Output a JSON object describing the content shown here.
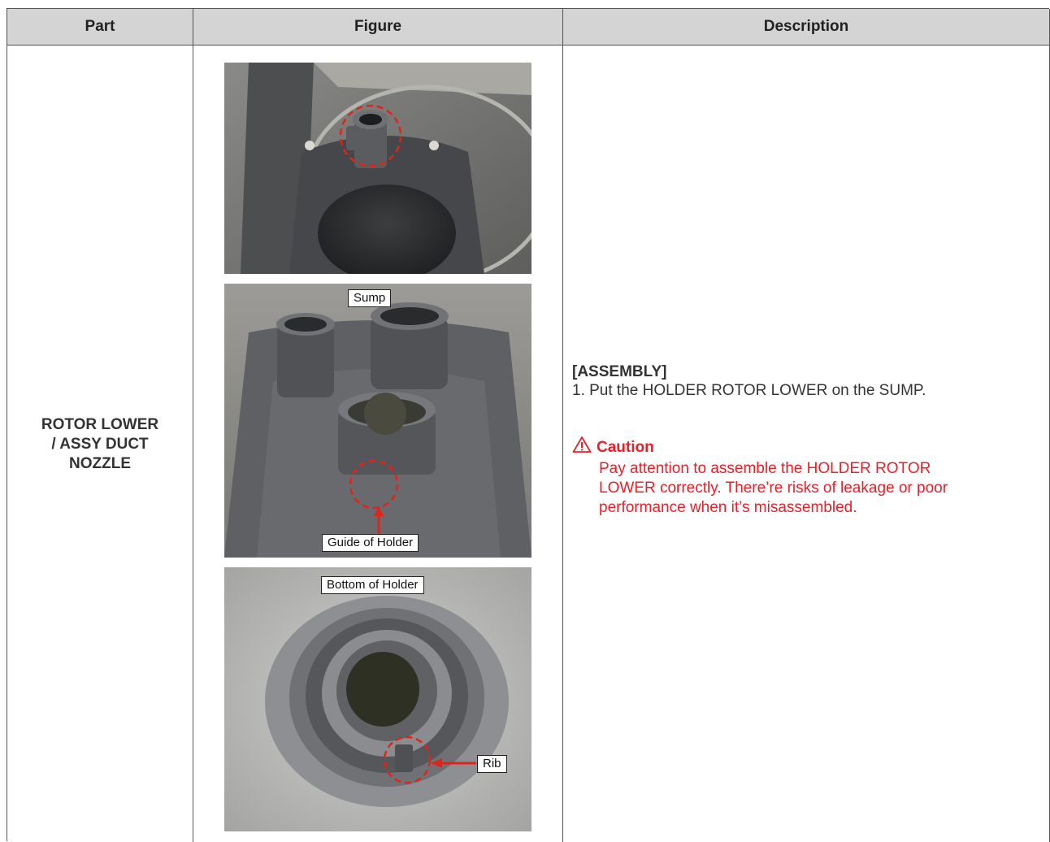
{
  "table": {
    "headers": {
      "part": "Part",
      "figure": "Figure",
      "description": "Description"
    }
  },
  "row": {
    "part_lines": [
      "ROTOR LOWER",
      "/ ASSY DUCT",
      "NOZZLE"
    ],
    "figure": {
      "labels": {
        "sump": "Sump",
        "guide_of_holder": "Guide of Holder",
        "bottom_of_holder": "Bottom of Holder",
        "rib": "Rib"
      }
    },
    "description": {
      "heading": "[ASSEMBLY]",
      "step1": "1. Put the HOLDER ROTOR LOWER on the SUMP.",
      "caution_title": "Caution",
      "caution_lines": [
        "Pay attention to assemble the HOLDER ROTOR",
        "LOWER correctly. There’re risks of leakage or poor",
        "performance when it’s misassembled."
      ]
    }
  },
  "colors": {
    "header_bg": "#d4d4d4",
    "caution_red": "#e8202a",
    "marker_red": "#e2231a"
  },
  "icons": [
    "warning-triangle-icon"
  ]
}
